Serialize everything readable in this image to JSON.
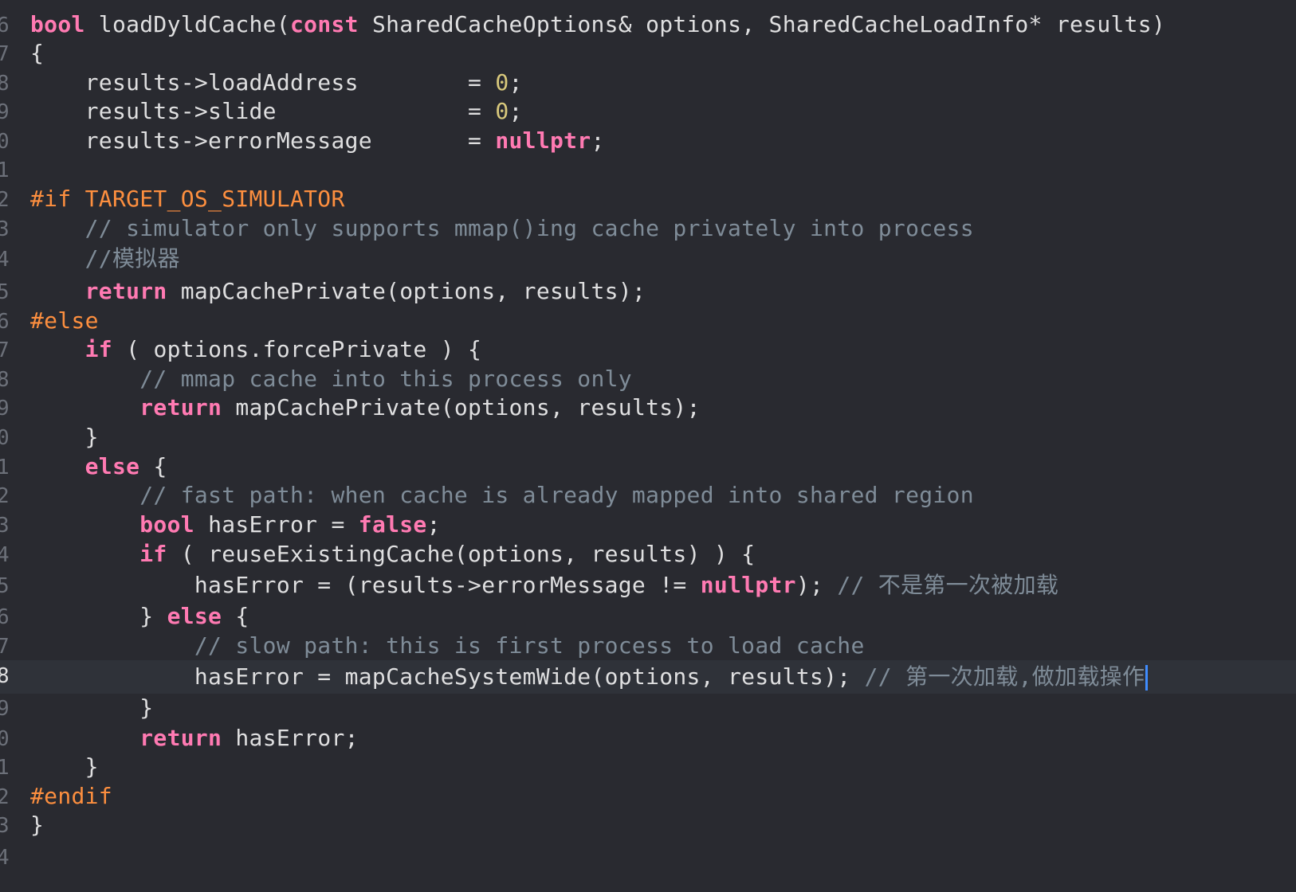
{
  "editor": {
    "lines": [
      {
        "number": "6",
        "tokens": [
          {
            "t": "bool",
            "k": "kw"
          },
          {
            "t": " loadDyldCache(",
            "k": "plain"
          },
          {
            "t": "const",
            "k": "kw"
          },
          {
            "t": " SharedCacheOptions& options, SharedCacheLoadInfo* results)",
            "k": "plain"
          }
        ]
      },
      {
        "number": "7",
        "tokens": [
          {
            "t": "{",
            "k": "plain"
          }
        ]
      },
      {
        "number": "8",
        "tokens": [
          {
            "t": "    results->loadAddress        = ",
            "k": "plain"
          },
          {
            "t": "0",
            "k": "num"
          },
          {
            "t": ";",
            "k": "plain"
          }
        ]
      },
      {
        "number": "9",
        "tokens": [
          {
            "t": "    results->slide              = ",
            "k": "plain"
          },
          {
            "t": "0",
            "k": "num"
          },
          {
            "t": ";",
            "k": "plain"
          }
        ]
      },
      {
        "number": "0",
        "tokens": [
          {
            "t": "    results->errorMessage       = ",
            "k": "plain"
          },
          {
            "t": "nullptr",
            "k": "kw"
          },
          {
            "t": ";",
            "k": "plain"
          }
        ]
      },
      {
        "number": "1",
        "tokens": []
      },
      {
        "number": "2",
        "tokens": [
          {
            "t": "#if TARGET_OS_SIMULATOR",
            "k": "pp"
          }
        ]
      },
      {
        "number": "3",
        "tokens": [
          {
            "t": "    ",
            "k": "plain"
          },
          {
            "t": "// simulator only supports mmap()ing cache privately into process",
            "k": "cm"
          }
        ]
      },
      {
        "number": "4",
        "tokens": [
          {
            "t": "    ",
            "k": "plain"
          },
          {
            "t": "//模拟器",
            "k": "cm"
          }
        ]
      },
      {
        "number": "5",
        "tokens": [
          {
            "t": "    ",
            "k": "plain"
          },
          {
            "t": "return",
            "k": "kw"
          },
          {
            "t": " mapCachePrivate(options, results);",
            "k": "plain"
          }
        ]
      },
      {
        "number": "6",
        "tokens": [
          {
            "t": "#else",
            "k": "pp"
          }
        ]
      },
      {
        "number": "7",
        "tokens": [
          {
            "t": "    ",
            "k": "plain"
          },
          {
            "t": "if",
            "k": "kw"
          },
          {
            "t": " ( options.forcePrivate ) {",
            "k": "plain"
          }
        ]
      },
      {
        "number": "8",
        "tokens": [
          {
            "t": "        ",
            "k": "plain"
          },
          {
            "t": "// mmap cache into this process only",
            "k": "cm"
          }
        ]
      },
      {
        "number": "9",
        "tokens": [
          {
            "t": "        ",
            "k": "plain"
          },
          {
            "t": "return",
            "k": "kw"
          },
          {
            "t": " mapCachePrivate(options, results);",
            "k": "plain"
          }
        ]
      },
      {
        "number": "0",
        "tokens": [
          {
            "t": "    }",
            "k": "plain"
          }
        ]
      },
      {
        "number": "1",
        "tokens": [
          {
            "t": "    ",
            "k": "plain"
          },
          {
            "t": "else",
            "k": "kw"
          },
          {
            "t": " {",
            "k": "plain"
          }
        ]
      },
      {
        "number": "2",
        "tokens": [
          {
            "t": "        ",
            "k": "plain"
          },
          {
            "t": "// fast path: when cache is already mapped into shared region",
            "k": "cm"
          }
        ]
      },
      {
        "number": "3",
        "tokens": [
          {
            "t": "        ",
            "k": "plain"
          },
          {
            "t": "bool",
            "k": "kw"
          },
          {
            "t": " hasError = ",
            "k": "plain"
          },
          {
            "t": "false",
            "k": "kw"
          },
          {
            "t": ";",
            "k": "plain"
          }
        ]
      },
      {
        "number": "4",
        "tokens": [
          {
            "t": "        ",
            "k": "plain"
          },
          {
            "t": "if",
            "k": "kw"
          },
          {
            "t": " ( reuseExistingCache(options, results) ) {",
            "k": "plain"
          }
        ]
      },
      {
        "number": "5",
        "tokens": [
          {
            "t": "            hasError = (results->errorMessage != ",
            "k": "plain"
          },
          {
            "t": "nullptr",
            "k": "kw"
          },
          {
            "t": "); ",
            "k": "plain"
          },
          {
            "t": "// 不是第一次被加载",
            "k": "cm"
          }
        ]
      },
      {
        "number": "6",
        "tokens": [
          {
            "t": "        } ",
            "k": "plain"
          },
          {
            "t": "else",
            "k": "kw"
          },
          {
            "t": " {",
            "k": "plain"
          }
        ]
      },
      {
        "number": "7",
        "tokens": [
          {
            "t": "            ",
            "k": "plain"
          },
          {
            "t": "// slow path: this is first process to load cache",
            "k": "cm"
          }
        ]
      },
      {
        "number": "8",
        "tokens": [
          {
            "t": "            hasError = mapCacheSystemWide(options, results); ",
            "k": "plain"
          },
          {
            "t": "// 第一次加载,做加载操作",
            "k": "cm"
          }
        ],
        "current": true
      },
      {
        "number": "9",
        "tokens": [
          {
            "t": "        }",
            "k": "plain"
          }
        ]
      },
      {
        "number": "0",
        "tokens": [
          {
            "t": "        ",
            "k": "plain"
          },
          {
            "t": "return",
            "k": "kw"
          },
          {
            "t": " hasError;",
            "k": "plain"
          }
        ]
      },
      {
        "number": "1",
        "tokens": [
          {
            "t": "    }",
            "k": "plain"
          }
        ]
      },
      {
        "number": "2",
        "tokens": [
          {
            "t": "#endif",
            "k": "pp"
          }
        ]
      },
      {
        "number": "3",
        "tokens": [
          {
            "t": "}",
            "k": "plain"
          }
        ]
      },
      {
        "number": "4",
        "tokens": []
      }
    ]
  },
  "colors": {
    "background": "#292a30",
    "current_line": "#2f3239",
    "keyword": "#ff7ab2",
    "preprocessor": "#fd8f3f",
    "number": "#d9c97c",
    "comment": "#7f8c98",
    "plain": "#dfdfe0",
    "cursor": "#3f8cff"
  }
}
